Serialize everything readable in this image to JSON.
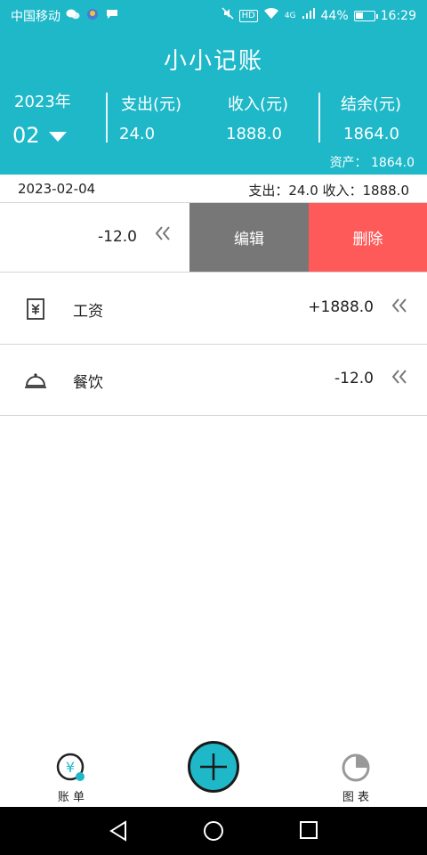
{
  "status_bar": {
    "carrier": "中国移动",
    "network_badge": "HD",
    "signal_type": "4G",
    "battery_percent": "44%",
    "time": "16:29",
    "battery_level": 0.44
  },
  "header": {
    "title": "小小记账",
    "year_label": "2023年",
    "month": "02",
    "expense_label": "支出(元)",
    "expense_value": "24.0",
    "income_label": "收入(元)",
    "income_value": "1888.0",
    "balance_label": "结余(元)",
    "balance_value": "1864.0",
    "assets_text": "资产：  1864.0"
  },
  "day_summary": {
    "date": "2023-02-04",
    "summary": "支出：24.0  收入：1888.0"
  },
  "swiped_row": {
    "amount": "-12.0",
    "edit_label": "编辑",
    "delete_label": "删除"
  },
  "records": [
    {
      "icon": "salary-icon",
      "category": "工资",
      "amount": "+1888.0"
    },
    {
      "icon": "dining-icon",
      "category": "餐饮",
      "amount": "-12.0"
    }
  ],
  "bottom_nav": {
    "bills_label": "账 单",
    "add_icon": "plus-icon",
    "charts_label": "图 表"
  },
  "colors": {
    "primary": "#1eb8c9",
    "edit": "#777777",
    "delete": "#ff5a5a"
  }
}
